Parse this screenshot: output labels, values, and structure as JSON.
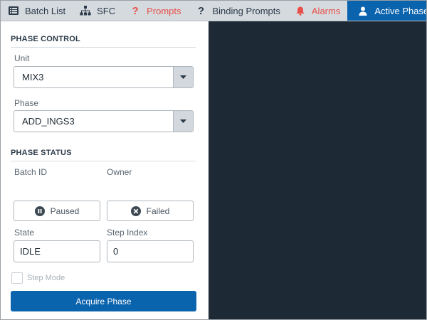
{
  "tabs": [
    {
      "label": "Batch List",
      "icon": "list-icon",
      "color": "#2b3a48"
    },
    {
      "label": "SFC",
      "icon": "sitemap-icon",
      "color": "#2b3a48"
    },
    {
      "label": "Prompts",
      "icon": "question-icon",
      "color": "#e8504a"
    },
    {
      "label": "Binding Prompts",
      "icon": "question-icon",
      "color": "#2b3a48"
    },
    {
      "label": "Alarms",
      "icon": "bell-icon",
      "color": "#e8504a"
    },
    {
      "label": "Active Phases",
      "icon": "user-icon",
      "color": "#ffffff",
      "active": true
    }
  ],
  "phase_control": {
    "title": "PHASE CONTROL",
    "unit_label": "Unit",
    "unit_value": "MIX3",
    "phase_label": "Phase",
    "phase_value": "ADD_INGS3"
  },
  "phase_status": {
    "title": "PHASE STATUS",
    "batch_id_label": "Batch ID",
    "owner_label": "Owner",
    "paused_label": "Paused",
    "failed_label": "Failed",
    "state_label": "State",
    "state_value": "IDLE",
    "step_index_label": "Step Index",
    "step_index_value": "0",
    "step_mode_label": "Step Mode",
    "step_mode_checked": false
  },
  "actions": {
    "acquire_label": "Acquire Phase"
  },
  "colors": {
    "accent": "#0a63ad",
    "alert": "#e8504a",
    "dark_pane": "#1d2a35",
    "tabbar": "#d5dadf"
  }
}
